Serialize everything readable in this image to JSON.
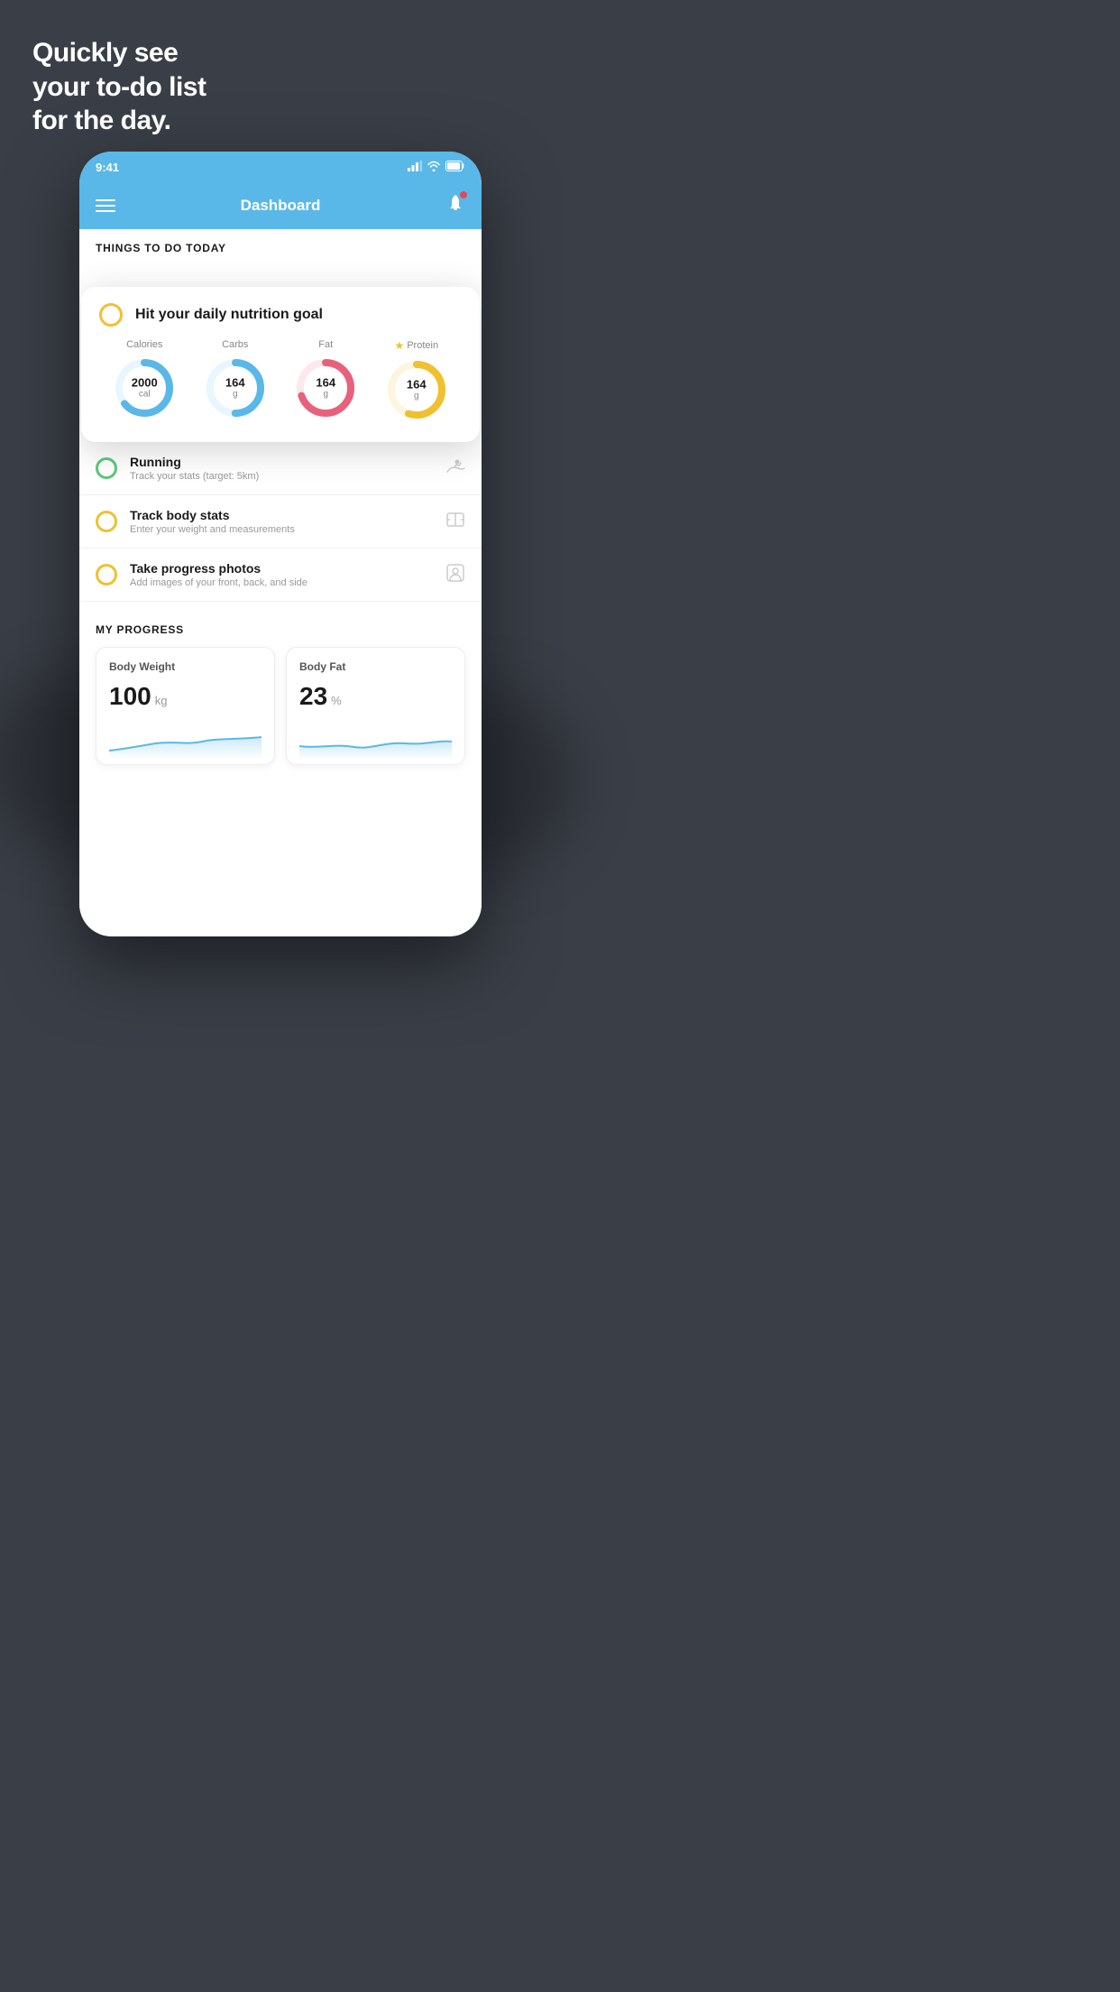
{
  "hero": {
    "line1": "Quickly see",
    "line2": "your to-do list",
    "line3": "for the day."
  },
  "statusBar": {
    "time": "9:41",
    "signal": "▲▲▲▲",
    "wifi": "wifi",
    "battery": "battery"
  },
  "header": {
    "title": "Dashboard"
  },
  "thingsToDoSection": {
    "label": "THINGS TO DO TODAY"
  },
  "floatingCard": {
    "title": "Hit your daily nutrition goal",
    "items": [
      {
        "label": "Calories",
        "value": "2000",
        "unit": "cal",
        "color": "#5ab8e8",
        "bgColor": "#e8f6fd",
        "star": false,
        "progress": 0.65
      },
      {
        "label": "Carbs",
        "value": "164",
        "unit": "g",
        "color": "#5ab8e8",
        "bgColor": "#e8f6fd",
        "star": false,
        "progress": 0.5
      },
      {
        "label": "Fat",
        "value": "164",
        "unit": "g",
        "color": "#e8617a",
        "bgColor": "#fde8ec",
        "star": false,
        "progress": 0.7
      },
      {
        "label": "Protein",
        "value": "164",
        "unit": "g",
        "color": "#f0c030",
        "bgColor": "#fdf5e0",
        "star": true,
        "progress": 0.55
      }
    ]
  },
  "todoItems": [
    {
      "title": "Running",
      "subtitle": "Track your stats (target: 5km)",
      "checkColor": "green",
      "icon": "shoe"
    },
    {
      "title": "Track body stats",
      "subtitle": "Enter your weight and measurements",
      "checkColor": "yellow",
      "icon": "scale"
    },
    {
      "title": "Take progress photos",
      "subtitle": "Add images of your front, back, and side",
      "checkColor": "yellow",
      "icon": "person"
    }
  ],
  "progressSection": {
    "label": "MY PROGRESS",
    "cards": [
      {
        "title": "Body Weight",
        "value": "100",
        "unit": "kg"
      },
      {
        "title": "Body Fat",
        "value": "23",
        "unit": "%"
      }
    ]
  },
  "colors": {
    "accent": "#5ab8e8",
    "background": "#3a3f47",
    "cardShadow": "rgba(0,0,0,0.18)"
  }
}
